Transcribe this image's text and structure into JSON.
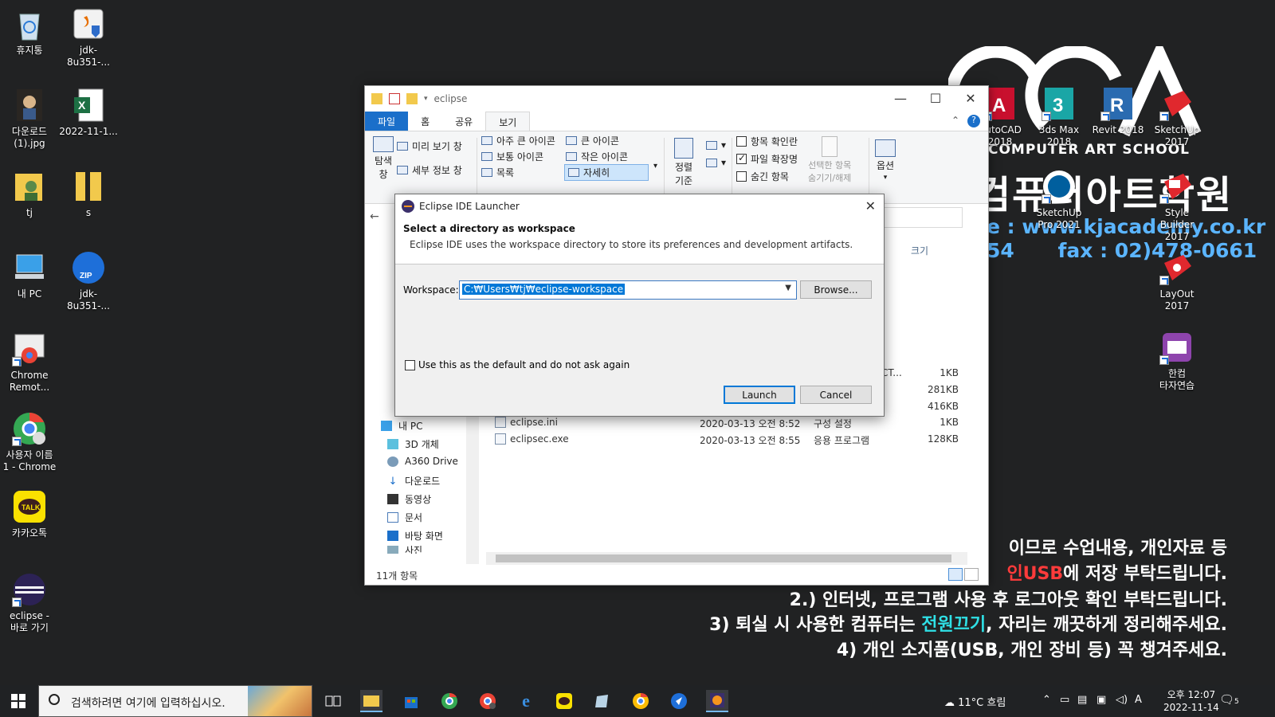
{
  "desktop": {
    "icons_left": [
      {
        "label": "휴지통",
        "icon": "recycle-bin-icon"
      },
      {
        "label": "jdk-8u351-...",
        "icon": "java-installer-icon"
      },
      {
        "label": "다운로드\n(1).jpg",
        "icon": "image-file-icon"
      },
      {
        "label": "2022-11-1...",
        "icon": "excel-file-icon"
      },
      {
        "label": "tj",
        "icon": "user-folder-icon"
      },
      {
        "label": "s",
        "icon": "zip-folder-icon"
      },
      {
        "label": "내 PC",
        "icon": "this-pc-icon"
      },
      {
        "label": "jdk-8u351-...",
        "icon": "zip-archive-icon"
      },
      {
        "label": "Chrome\nRemot...",
        "icon": "chrome-remote-icon"
      },
      {
        "label": "사용자 이름\n1 - Chrome",
        "icon": "chrome-user-icon"
      },
      {
        "label": "카카오톡",
        "icon": "kakaotalk-icon"
      },
      {
        "label": "eclipse -\n바로 가기",
        "icon": "eclipse-icon"
      }
    ],
    "icons_right": [
      {
        "label": "AutoCAD\n2018",
        "icon": "autocad-icon"
      },
      {
        "label": "3ds Max\n2018",
        "icon": "3dsmax-icon"
      },
      {
        "label": "Revit 2018",
        "icon": "revit-icon"
      },
      {
        "label": "SketchUp\n2017",
        "icon": "sketchup-icon"
      },
      {
        "label": "SketchUp\nPro 2021",
        "icon": "sketchup-pro-icon"
      },
      {
        "label": "Style Builder\n2017",
        "icon": "style-builder-icon"
      },
      {
        "label": "LayOut 2017",
        "icon": "layout-icon"
      },
      {
        "label": "한컴\n타자연습",
        "icon": "hancom-typing-icon"
      }
    ]
  },
  "wallpaper": {
    "school": "COMPUTER ART SCHOOL",
    "title": "컴퓨터아트학원",
    "url": "e : www.kjacademy.co.kr",
    "phone_tail": "54",
    "fax": "fax : 02)478-0661",
    "line1": "이므로 수업내용, 개인자료 등",
    "line2_red": "인USB",
    "line2_rest": "에 저장 부탁드립니다.",
    "line3": "2.) 인터넷, 프로그램 사용 후 로그아웃 확인 부탁드립니다.",
    "line4_a": "3) 퇴실 시 사용한 컴퓨터는 ",
    "line4_cyan": "전원끄기",
    "line4_b": ", 자리는 깨끗하게 정리해주세요.",
    "line5": "4) 개인 소지품(USB, 개인 장비 등) 꼭 챙겨주세요."
  },
  "explorer": {
    "title": "eclipse",
    "tabs": [
      "파일",
      "홈",
      "공유",
      "보기"
    ],
    "ribbon": {
      "nav_pane": "탐색\n창",
      "preview_pane": "미리 보기 창",
      "details_pane": "세부 정보 창",
      "layout_items": [
        "아주 큰 아이콘",
        "큰 아이콘",
        "보통 아이콘",
        "작은 아이콘",
        "목록",
        "자세히"
      ],
      "sort": "정렬\n기준",
      "item_checkboxes": "항목 확인란",
      "file_extensions": "파일 확장명",
      "hidden_items": "숨긴 항목",
      "hide_selected": "선택한 항목\n숨기기/해제",
      "options": "옵션"
    },
    "nav_items": [
      "내 PC",
      "3D 개체",
      "A360 Drive",
      "다운로드",
      "동영상",
      "문서",
      "바탕 화면",
      "사진"
    ],
    "column_size": "크기",
    "files": [
      {
        "name": "",
        "date": "",
        "type": "",
        "size": "1KB",
        "partial": "DUCT..."
      },
      {
        "name": "",
        "date": "",
        "type": "",
        "size": "281KB"
      },
      {
        "name": "",
        "date": "",
        "type": "",
        "size": "416KB"
      },
      {
        "name": "eclipse.ini",
        "date": "2020-03-13 오전 8:52",
        "type": "구성 설정",
        "size": "1KB"
      },
      {
        "name": "eclipsec.exe",
        "date": "2020-03-13 오전 8:55",
        "type": "응용 프로그램",
        "size": "128KB"
      }
    ],
    "status": "11개 항목"
  },
  "launcher": {
    "title": "Eclipse IDE Launcher",
    "heading": "Select a directory as workspace",
    "description": "Eclipse IDE uses the workspace directory to store its preferences and development artifacts.",
    "workspace_label": "Workspace:",
    "workspace_value": "C:₩Users₩tj₩eclipse-workspace",
    "browse": "Browse...",
    "default_checkbox": "Use this as the default and do not ask again",
    "launch": "Launch",
    "cancel": "Cancel"
  },
  "taskbar": {
    "search_placeholder": "검색하려면 여기에 입력하십시오.",
    "weather": "11°C  흐림",
    "time": "오후 12:07",
    "date": "2022-11-14",
    "ime": "A",
    "notifications": "5"
  }
}
